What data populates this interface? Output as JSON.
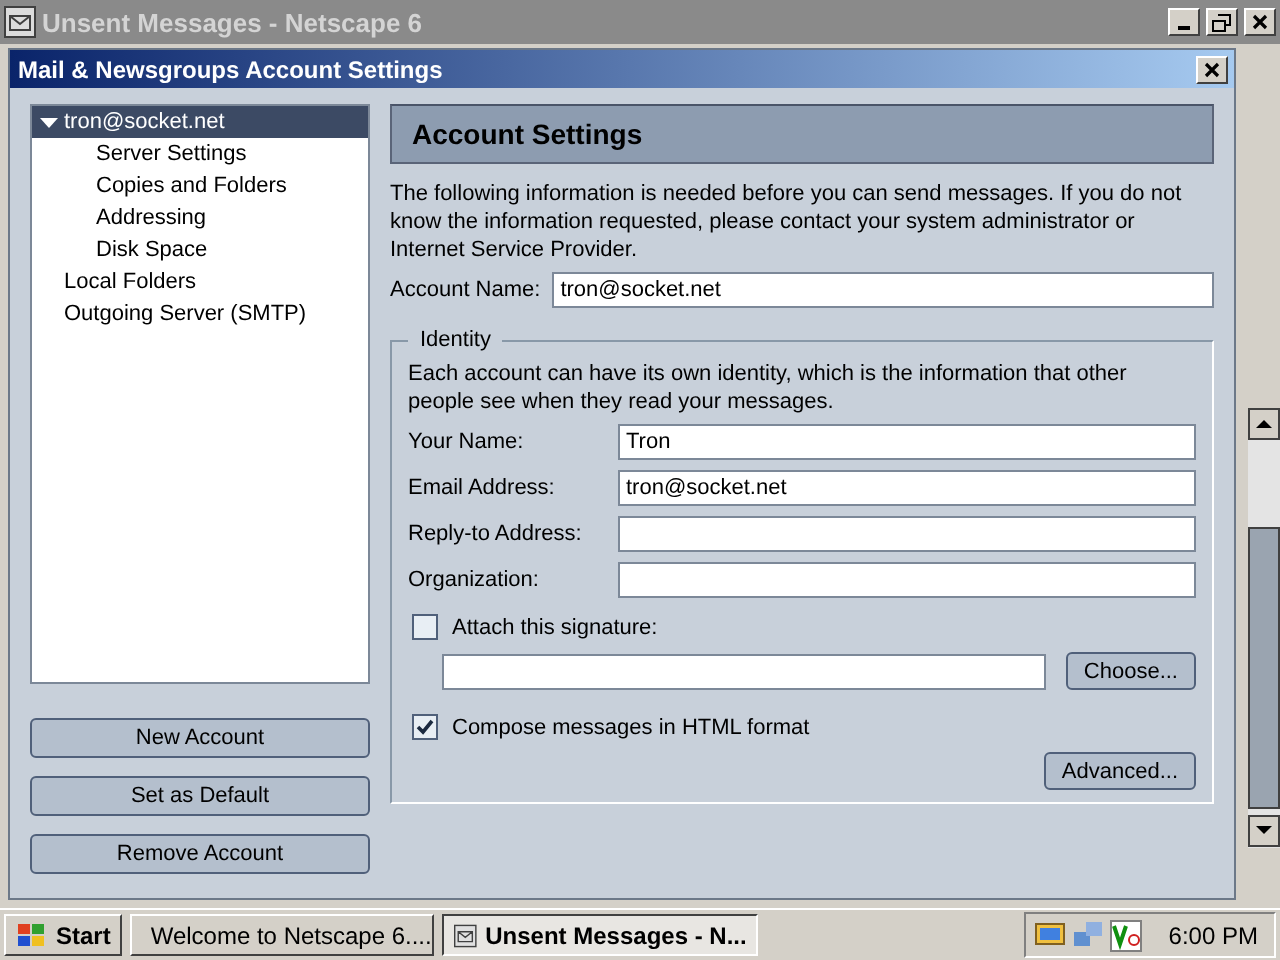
{
  "background_window": {
    "title": "Unsent Messages - Netscape 6"
  },
  "dialog": {
    "title": "Mail & Newsgroups Account Settings"
  },
  "tree": [
    {
      "label": "tron@socket.net",
      "expanded": true,
      "selected": true,
      "children": [
        {
          "label": "Server Settings",
          "selected": false
        },
        {
          "label": "Copies and Folders",
          "selected": false
        },
        {
          "label": "Addressing",
          "selected": false
        },
        {
          "label": "Disk Space",
          "selected": false
        }
      ]
    },
    {
      "label": "Local Folders",
      "selected": false
    },
    {
      "label": "Outgoing Server (SMTP)",
      "selected": false
    }
  ],
  "account_buttons": [
    "New Account",
    "Set as Default",
    "Remove Account"
  ],
  "panel": {
    "title": "Account Settings",
    "description": "The following information is needed before you can send messages. If you do not know the information requested, please contact your system administrator or Internet Service Provider.",
    "account_name": {
      "label": "Account Name:",
      "value": "tron@socket.net"
    }
  },
  "identity": {
    "legend": "Identity",
    "description": "Each account can have its own identity, which is the information that other people see when they read your messages.",
    "fields": [
      {
        "label": "Your Name:",
        "value": "Tron"
      },
      {
        "label": "Email Address:",
        "value": "tron@socket.net"
      },
      {
        "label": "Reply-to Address:"
      },
      {
        "label": "Organization:"
      }
    ],
    "signature": {
      "label": "Attach this signature:",
      "checked": false,
      "button": "Choose..."
    },
    "html_format": {
      "label": "Compose messages in HTML format",
      "checked": true
    },
    "advanced_button": "Advanced..."
  },
  "taskbar": {
    "start": "Start",
    "tasks": [
      {
        "label": "Welcome to Netscape 6....",
        "selected": false
      },
      {
        "label": "Unsent Messages - N...",
        "selected": true
      }
    ],
    "clock": "6:00 PM"
  }
}
